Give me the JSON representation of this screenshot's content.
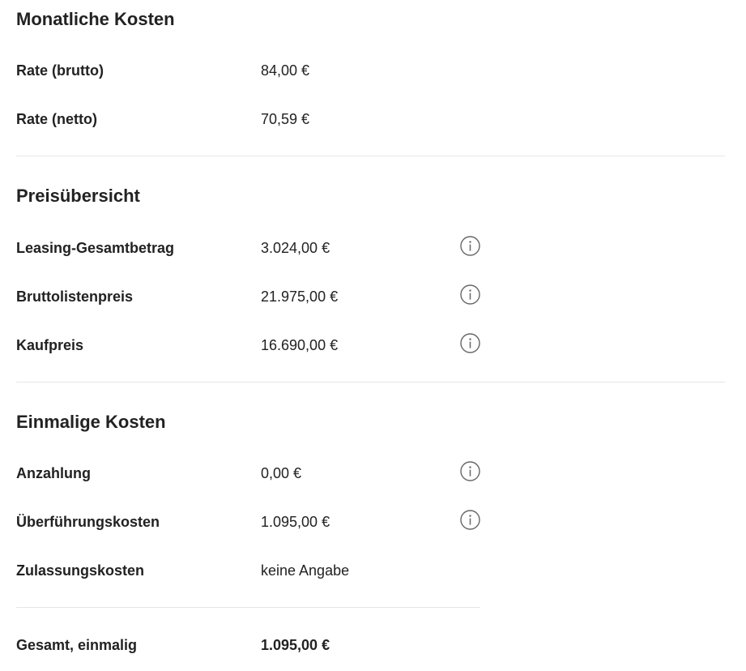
{
  "monthly": {
    "title": "Monatliche Kosten",
    "rows": [
      {
        "label": "Rate (brutto)",
        "value": "84,00 €"
      },
      {
        "label": "Rate (netto)",
        "value": "70,59 €"
      }
    ]
  },
  "overview": {
    "title": "Preisübersicht",
    "rows": [
      {
        "label": "Leasing-Gesamtbetrag",
        "value": "3.024,00 €"
      },
      {
        "label": "Bruttolistenpreis",
        "value": "21.975,00 €"
      },
      {
        "label": "Kaufpreis",
        "value": "16.690,00 €"
      }
    ]
  },
  "onetime": {
    "title": "Einmalige Kosten",
    "rows": [
      {
        "label": "Anzahlung",
        "value": "0,00 €"
      },
      {
        "label": "Überführungskosten",
        "value": "1.095,00 €"
      },
      {
        "label": "Zulassungskosten",
        "value": "keine Angabe"
      }
    ],
    "total": {
      "label": "Gesamt, einmalig",
      "value": "1.095,00 €"
    }
  },
  "icons": {
    "info": "info-circle-icon"
  },
  "colors": {
    "text": "#222222",
    "icon": "#666666",
    "divider": "#e6e6e6"
  }
}
